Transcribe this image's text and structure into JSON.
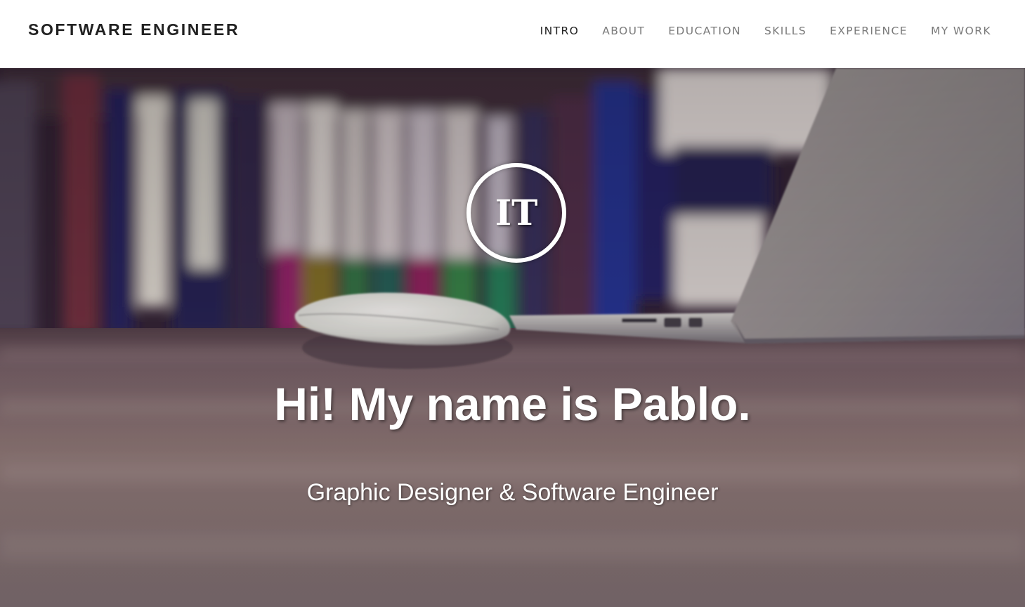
{
  "navbar": {
    "brand": "SOFTWARE ENGINEER",
    "items": [
      {
        "label": "INTRO",
        "active": true
      },
      {
        "label": "ABOUT",
        "active": false
      },
      {
        "label": "EDUCATION",
        "active": false
      },
      {
        "label": "SKILLS",
        "active": false
      },
      {
        "label": "EXPERIENCE",
        "active": false
      },
      {
        "label": "MY WORK",
        "active": false
      }
    ]
  },
  "hero": {
    "logo_text": "IT",
    "title": "Hi! My name is Pablo.",
    "subtitle": "Graphic Designer & Software Engineer",
    "background": "blurred-desk-photo-laptop-mouse-books"
  },
  "colors": {
    "brand_text": "#222222",
    "nav_text": "#7a7a7a",
    "nav_active": "#222222",
    "hero_text": "#ffffff"
  }
}
